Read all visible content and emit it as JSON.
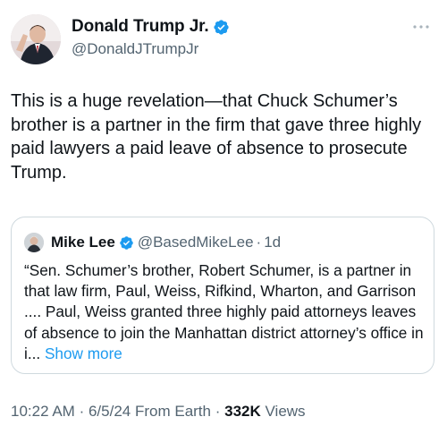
{
  "author": {
    "display_name": "Donald Trump Jr.",
    "handle": "@DonaldJTrumpJr",
    "verified": true
  },
  "tweet": {
    "text": "This is a huge revelation—that Chuck Schumer’s brother is a partner in the firm that gave three highly paid lawyers a paid leave of absence to prosecute Trump."
  },
  "quote": {
    "display_name": "Mike Lee",
    "handle": "@BasedMikeLee",
    "separator": "·",
    "time": "1d",
    "text": "“Sen. Schumer’s brother, Robert Schumer, is a partner in that law firm, Paul, Weiss, Rifkind, Wharton, and Garrison .... Paul, Weiss granted three highly paid attorneys leaves of absence to join the Manhattan district attorney’s office in i...",
    "show_more": "Show more"
  },
  "meta": {
    "time": "10:22 AM",
    "separator": "·",
    "date": "6/5/24",
    "source": "From Earth",
    "views_count": "332K",
    "views_label": "Views"
  },
  "colors": {
    "verified": "#1d9bf0",
    "link": "#1d9bf0",
    "secondary_text": "#536471",
    "border": "#cfd9de"
  },
  "icons": {
    "verified": "verified-badge-icon",
    "more": "more-options-icon"
  }
}
